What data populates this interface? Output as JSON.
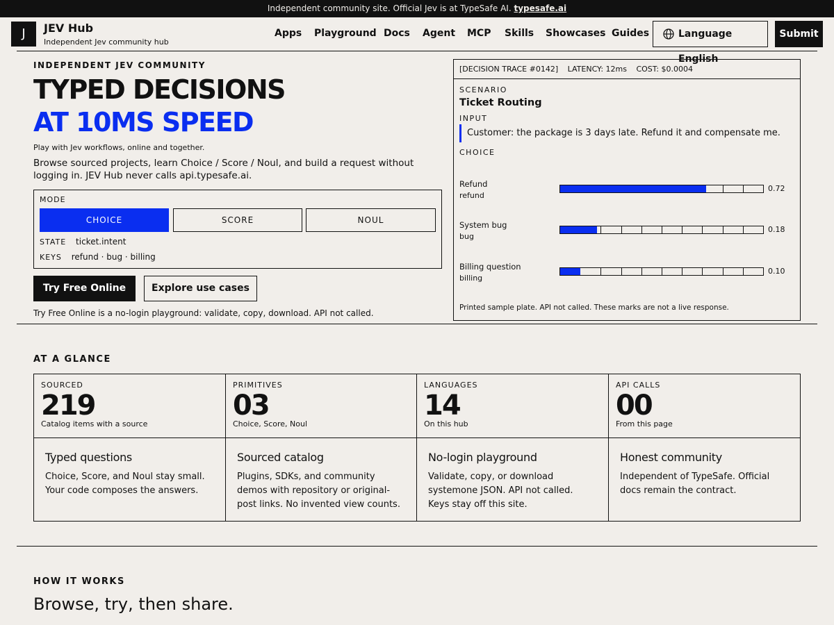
{
  "banner": {
    "text": "Independent community site. Official Jev is at TypeSafe AI.",
    "link": "typesafe.ai"
  },
  "header": {
    "logo_letter": "J",
    "brand": "JEV Hub",
    "brand_sub": "Independent Jev community hub",
    "nav": [
      "Apps",
      "Playground",
      "Docs",
      "Agent",
      "MCP",
      "Skills",
      "Showcases",
      "Guides"
    ],
    "language_label": "Language English",
    "submit_label": "Submit"
  },
  "hero": {
    "eyebrow": "INDEPENDENT JEV COMMUNITY",
    "headline_1": "TYPED DECISIONS",
    "headline_2": "AT 10MS SPEED",
    "tagline": "Play with Jev workflows, online and together.",
    "intro": "Browse sourced projects, learn Choice / Score / Noul, and build a request without logging in. JEV Hub never calls api.typesafe.ai.",
    "mode_label": "MODE",
    "modes": [
      "CHOICE",
      "SCORE",
      "NOUL"
    ],
    "active_mode": "CHOICE",
    "state_key": "STATE",
    "state_value": "ticket.intent",
    "keys_key": "KEYS",
    "keys_value": "refund · bug · billing",
    "cta_primary": "Try Free Online",
    "cta_secondary": "Explore use cases",
    "note": "Try Free Online is a no-login playground: validate, copy, download. API not called."
  },
  "trace": {
    "id": "[DECISION TRACE #0142]",
    "latency": "LATENCY: 12ms",
    "cost": "COST: $0.0004",
    "scenario_label": "SCENARIO",
    "scenario": "Ticket Routing",
    "input_label": "INPUT",
    "input": "Customer: the package is 3 days late. Refund it and compensate me.",
    "choice_label": "CHOICE",
    "choices": [
      {
        "name": "Refund",
        "key": "refund",
        "value": 0.72,
        "value_label": "0.72"
      },
      {
        "name": "System bug",
        "key": "bug",
        "value": 0.18,
        "value_label": "0.18"
      },
      {
        "name": "Billing question",
        "key": "billing",
        "value": 0.1,
        "value_label": "0.10"
      }
    ],
    "footer": "Printed sample plate. API not called. These marks are not a live response."
  },
  "glance": {
    "title": "AT A GLANCE",
    "stats": [
      {
        "label": "SOURCED",
        "number": "219",
        "caption": "Catalog items with a source"
      },
      {
        "label": "PRIMITIVES",
        "number": "03",
        "caption": "Choice, Score, Noul"
      },
      {
        "label": "LANGUAGES",
        "number": "14",
        "caption": "On this hub"
      },
      {
        "label": "API CALLS",
        "number": "00",
        "caption": "From this page"
      }
    ],
    "features": [
      {
        "title": "Typed questions",
        "body": "Choice, Score, and Noul stay small. Your code composes the answers."
      },
      {
        "title": "Sourced catalog",
        "body": "Plugins, SDKs, and community demos with repository or original-post links. No invented view counts."
      },
      {
        "title": "No-login playground",
        "body": "Validate, copy, or download systemone JSON. API not called. Keys stay off this site."
      },
      {
        "title": "Honest community",
        "body": "Independent of TypeSafe. Official docs remain the contract."
      }
    ]
  },
  "how": {
    "title": "HOW IT WORKS",
    "subtitle": "Browse, try, then share."
  },
  "colors": {
    "accent": "#0a2ef0",
    "ink": "#111111",
    "paper": "#f1eeea"
  }
}
